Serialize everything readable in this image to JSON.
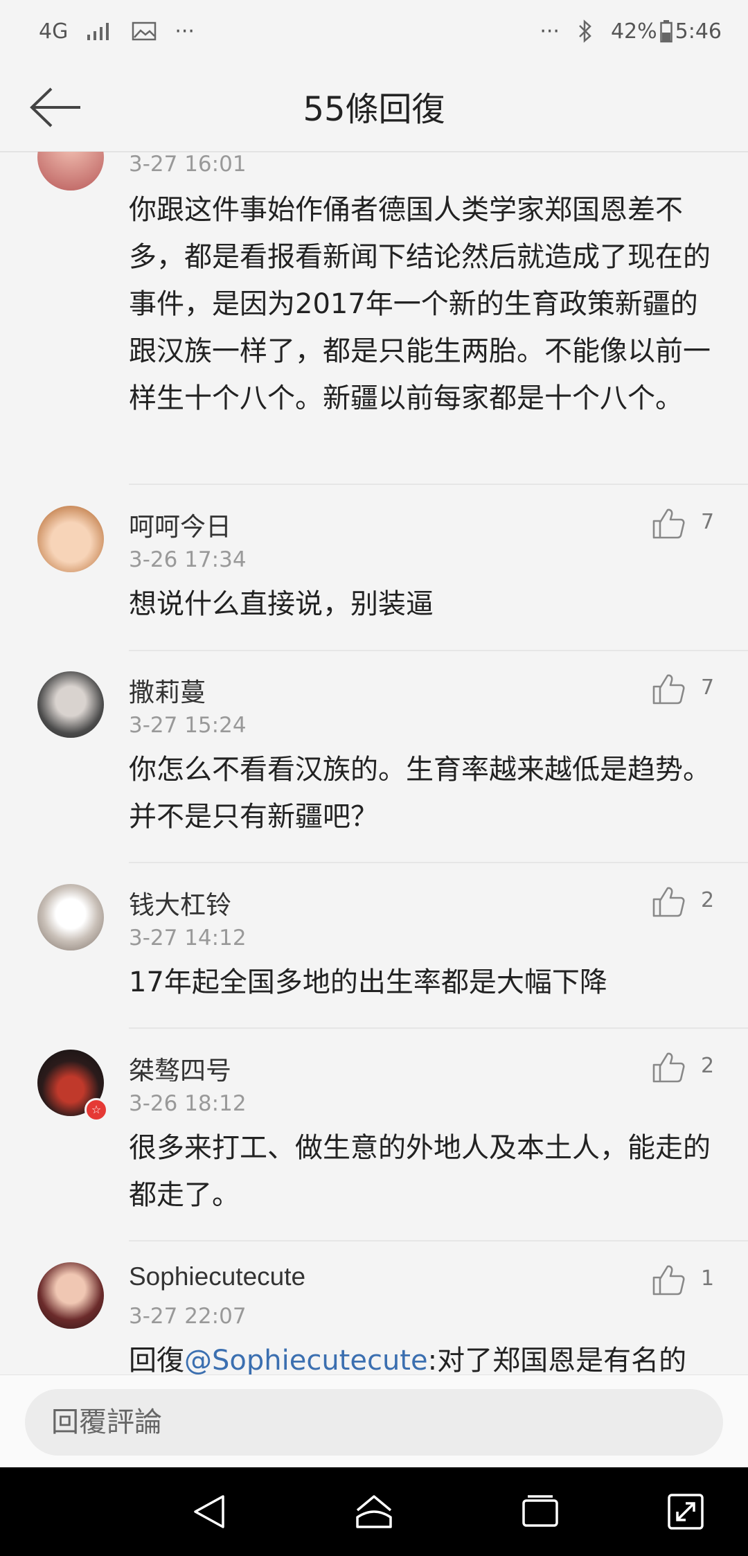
{
  "status_bar": {
    "network": "4G",
    "dots": "···",
    "battery": "42%",
    "time": "5:46"
  },
  "header": {
    "title": "55條回復"
  },
  "comments": [
    {
      "time": "3-27 16:01",
      "text": "你跟这件事始作俑者德国人类学家郑国恩差不多，都是看报看新闻下结论然后就造成了现在的事件，是因为2017年一个新的生育政策新疆的跟汉族一样了，都是只能生两胎。不能像以前一样生十个八个。新疆以前每家都是十个八个。"
    },
    {
      "name": "呵呵今日",
      "time": "3-26 17:34",
      "likes": "7",
      "text": "想说什么直接说，别装逼"
    },
    {
      "name": "撒莉蔓",
      "time": "3-27 15:24",
      "likes": "7",
      "text": "你怎么不看看汉族的。生育率越来越低是趋势。并不是只有新疆吧？"
    },
    {
      "name": "钱大杠铃",
      "time": "3-27 14:12",
      "likes": "2",
      "text": "17年起全国多地的出生率都是大幅下降"
    },
    {
      "name": "桀骜四号",
      "time": "3-26 18:12",
      "likes": "2",
      "text": "很多来打工、做生意的外地人及本土人，能走的都走了。"
    },
    {
      "name": "Sophiecutecute",
      "time": "3-27 22:07",
      "likes": "1",
      "text_prefix": "回復",
      "mention": "@Sophiecutecute",
      "text_suffix": ":对了郑国恩是有名的"
    }
  ],
  "reply": {
    "placeholder": "回覆評論"
  },
  "colors": {
    "accent_link": "#3b6fb0",
    "background": "#f4f4f4"
  }
}
